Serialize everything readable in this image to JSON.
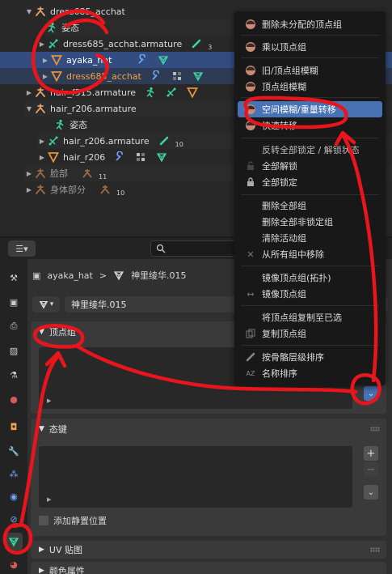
{
  "outliner": {
    "rows": [
      {
        "label": "dress685_acchat"
      },
      {
        "label": "姿态"
      },
      {
        "label": "dress685_acchat.armature",
        "count": "3"
      },
      {
        "label": "ayaka_hat"
      },
      {
        "label": "dress685_acchat"
      },
      {
        "label": "hair_f315.armature"
      },
      {
        "label": "hair_r206.armature"
      },
      {
        "label": "姿态"
      },
      {
        "label": "hair_r206.armature",
        "count": "10"
      },
      {
        "label": "hair_r206"
      },
      {
        "label": "脸部",
        "count": "11"
      },
      {
        "label": "身体部分",
        "count": "10"
      }
    ]
  },
  "properties": {
    "breadcrumb": {
      "object": "ayaka_hat",
      "separator": ">",
      "mesh": "神里绫华.015"
    },
    "mesh_name": "神里绫华.015",
    "panels": {
      "vertex_groups": "顶点组",
      "shape_keys": "形态键",
      "shape_keys_visible": "态键",
      "relative_label": "添加静置位置",
      "uv_maps": "UV 贴图",
      "color_attributes": "颜色属性"
    }
  },
  "menu": {
    "items": [
      "删除未分配的顶点组",
      "乘以顶点组",
      "旧/顶点组模糊",
      "顶点组模糊",
      "空间模糊/重量转移",
      "快速转移",
      "反转全部锁定 / 解锁状态",
      "全部解锁",
      "全部锁定",
      "删除全部组",
      "删除全部非锁定组",
      "清除活动组",
      "从所有组中移除",
      "镜像顶点组(拓扑)",
      "镜像顶点组",
      "将顶点组复制至已选",
      "复制顶点组",
      "按骨骼层级排序",
      "名称排序"
    ],
    "shown": {
      "quick_transfer": "快速转移"
    }
  },
  "colors": {
    "accent": "#4772b3",
    "selection": "#334d80",
    "annotation": "#e8161c",
    "armature": "#e8a069",
    "bone": "#3cd6a6",
    "mesh": "#e7933b"
  }
}
